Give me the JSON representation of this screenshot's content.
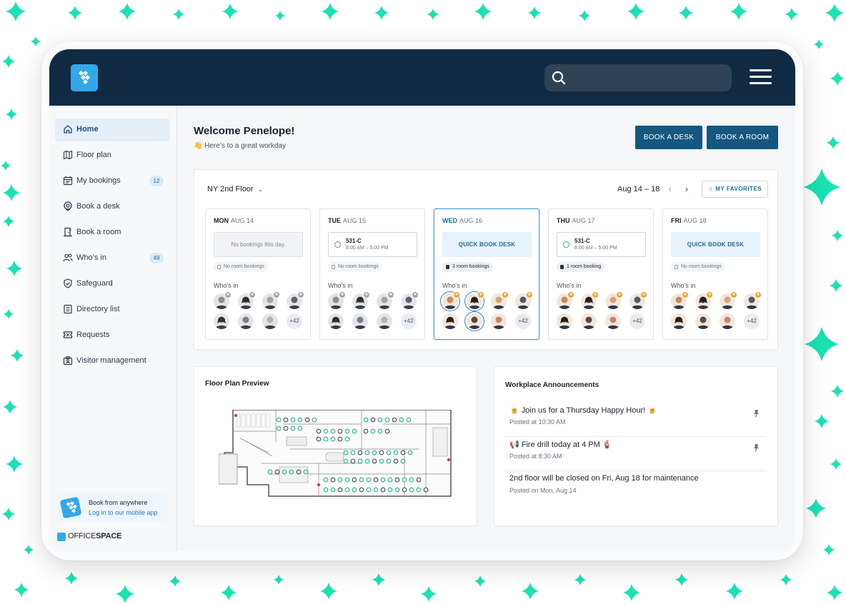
{
  "colors": {
    "topbar": "#102a43",
    "accent": "#15577e",
    "brand_blue": "#33a8e8",
    "sparkle": "#19e2b3"
  },
  "header": {
    "logo_icon": "officespace-logo-icon",
    "search_icon": "search-icon",
    "search_value": "",
    "menu_icon": "hamburger-menu-icon"
  },
  "sidebar": {
    "items": [
      {
        "label": "Home",
        "icon": "home-icon",
        "active": true,
        "badge": ""
      },
      {
        "label": "Floor plan",
        "icon": "floor-plan-icon",
        "badge": ""
      },
      {
        "label": "My bookings",
        "icon": "calendar-icon",
        "badge": "12"
      },
      {
        "label": "Book a desk",
        "icon": "location-pin-icon",
        "badge": ""
      },
      {
        "label": "Book a room",
        "icon": "door-icon",
        "badge": ""
      },
      {
        "label": "Who’s in",
        "icon": "people-icon",
        "badge": "49"
      },
      {
        "label": "Safeguard",
        "icon": "shield-check-icon",
        "badge": ""
      },
      {
        "label": "Directory list",
        "icon": "directory-icon",
        "badge": ""
      },
      {
        "label": "Requests",
        "icon": "ticket-icon",
        "badge": ""
      },
      {
        "label": "Visitor management",
        "icon": "visitor-badge-icon",
        "badge": ""
      }
    ],
    "promo": {
      "title": "Book from anywhere",
      "link": "Log in to our mobile app"
    },
    "brand": {
      "part1": "OFFICE",
      "part2": "SPACE"
    }
  },
  "main": {
    "welcome": "Welcome Penelope!",
    "greeting_emoji": "👋",
    "greeting": "Here’s to a great workday",
    "book_desk": "BOOK A DESK",
    "book_room": "BOOK A ROOM"
  },
  "schedule": {
    "floor": "NY 2nd Floor",
    "range": "Aug 14 – 18",
    "favorites": "MY FAVORITES",
    "who_label": "Who’s in",
    "more_label": "+42",
    "days": [
      {
        "dow": "MON",
        "date": "AUG 14",
        "booking_type": "empty",
        "booking_text": "No bookings this day.",
        "rooms": "No room bookings"
      },
      {
        "dow": "TUE",
        "date": "AUG 15",
        "booking_type": "booked",
        "desk": "531-C",
        "time": "8:00 AM – 5:00 PM",
        "rooms": "No room bookings"
      },
      {
        "dow": "WED",
        "date": "AUG 16",
        "booking_type": "quick",
        "booking_text": "QUICK BOOK DESK",
        "rooms": "3 room bookings",
        "selected": true
      },
      {
        "dow": "THU",
        "date": "AUG 17",
        "booking_type": "booked",
        "desk": "531-C",
        "time": "8:00 AM – 5:00 PM",
        "rooms": "1 room booking"
      },
      {
        "dow": "FRI",
        "date": "AUG 18",
        "booking_type": "quick",
        "booking_text": "QUICK BOOK DESK",
        "rooms": "No room bookings"
      }
    ]
  },
  "floor_preview": {
    "title": "Floor Plan Preview"
  },
  "announcements": {
    "title": "Workplace Announcements",
    "items": [
      {
        "text": "🍺 Join us for a Thursday Happy Hour! 🍺",
        "posted": "Posted at 10:30 AM",
        "pinned": true
      },
      {
        "text": "📢 Fire drill today at 4 PM 🧯",
        "posted": "Posted at 8:30 AM",
        "pinned": true
      },
      {
        "text": "2nd floor will be closed on Fri, Aug 18 for maintenance",
        "posted": "Posted on Mon, Aug 14",
        "pinned": false
      }
    ]
  }
}
